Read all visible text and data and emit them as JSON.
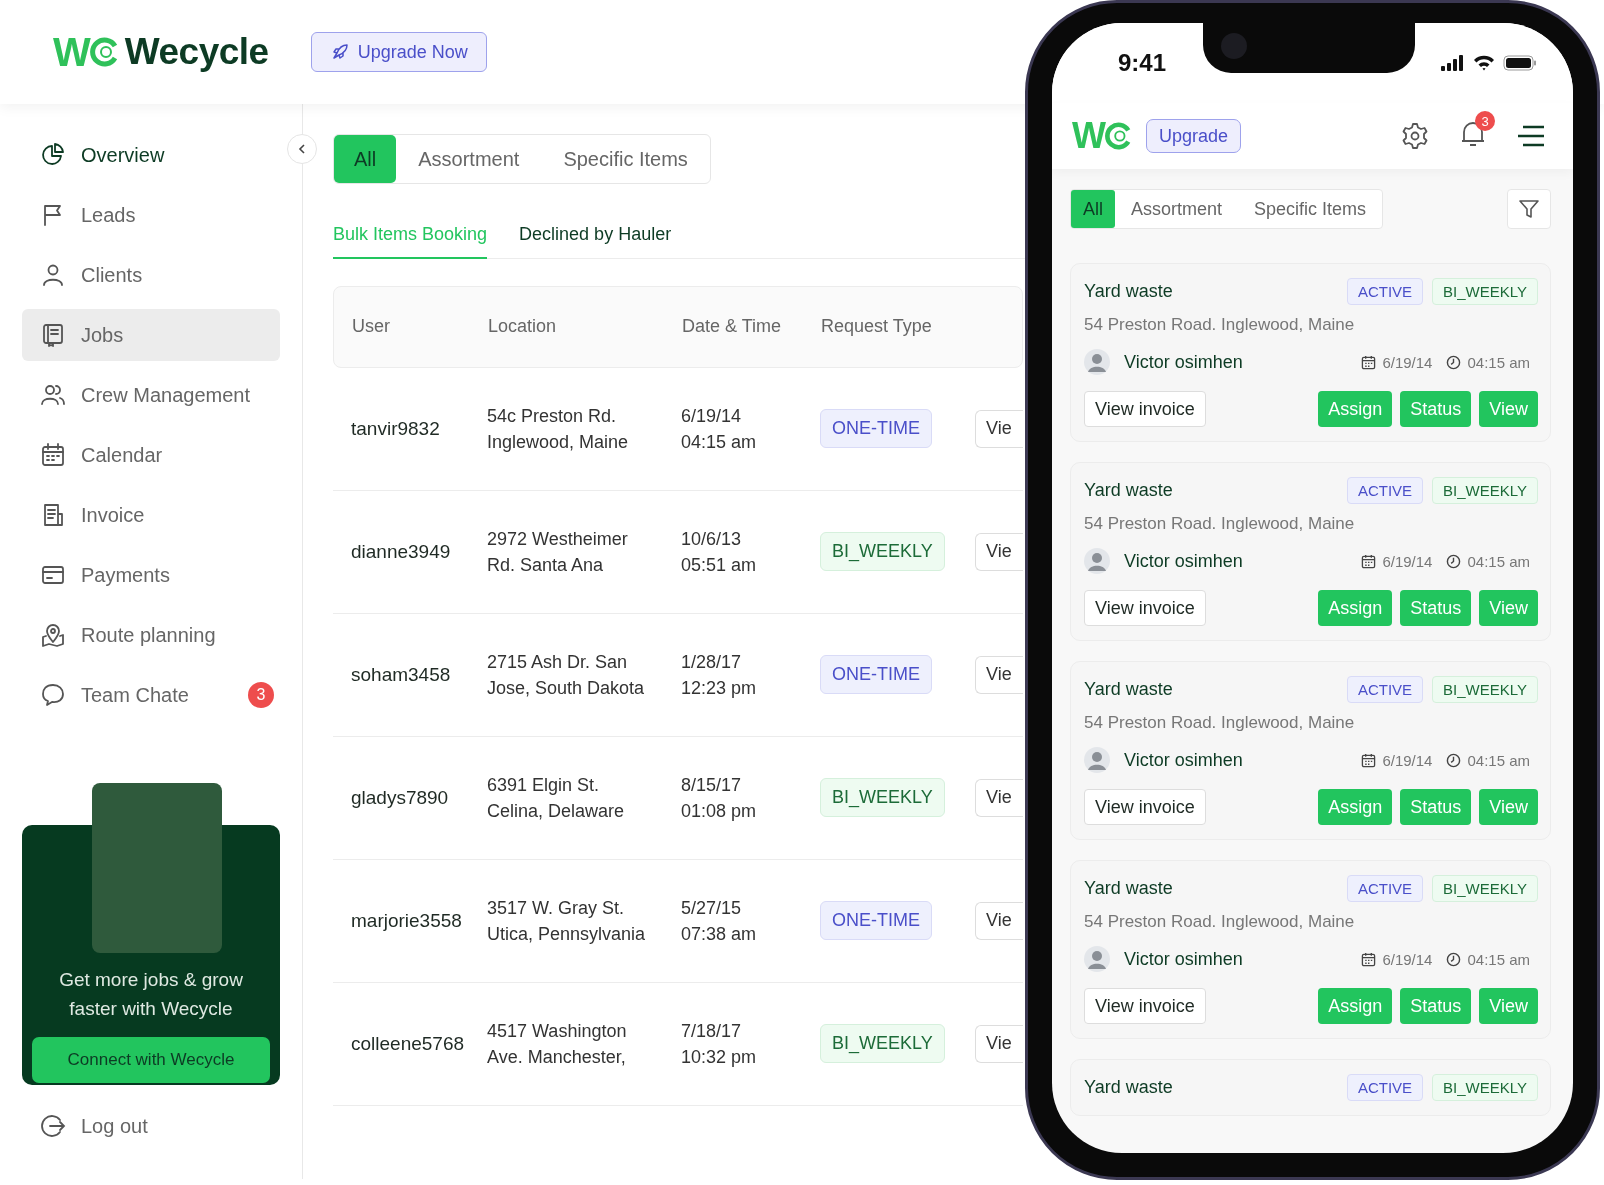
{
  "brand": {
    "logo_letter": "W",
    "name": "Wecycle"
  },
  "upgrade_button": "Upgrade Now",
  "sidebar": {
    "items": [
      {
        "label": "Overview",
        "selected": true,
        "highlighted": false
      },
      {
        "label": "Leads",
        "selected": false,
        "highlighted": false
      },
      {
        "label": "Clients",
        "selected": false,
        "highlighted": false
      },
      {
        "label": "Jobs",
        "selected": false,
        "highlighted": true
      },
      {
        "label": "Crew Management",
        "selected": false,
        "highlighted": false
      },
      {
        "label": "Calendar",
        "selected": false,
        "highlighted": false
      },
      {
        "label": "Invoice",
        "selected": false,
        "highlighted": false
      },
      {
        "label": "Payments",
        "selected": false,
        "highlighted": false
      },
      {
        "label": "Route planning",
        "selected": false,
        "highlighted": false
      },
      {
        "label": "Team Chate",
        "selected": false,
        "highlighted": false,
        "badge": "3"
      }
    ],
    "promo": {
      "text": "Get more jobs & grow faster with Wecycle",
      "button": "Connect with Wecycle"
    },
    "logout": "Log out"
  },
  "filter_tabs": [
    {
      "label": "All",
      "selected": true
    },
    {
      "label": "Assortment",
      "selected": false
    },
    {
      "label": "Specific Items",
      "selected": false
    }
  ],
  "sub_tabs": [
    {
      "label": "Bulk Items Booking",
      "selected": true
    },
    {
      "label": "Declined by Hauler",
      "selected": false
    }
  ],
  "table": {
    "columns": [
      "User",
      "Location",
      "Date & Time",
      "Request Type"
    ],
    "rows": [
      {
        "user": "tanvir9832",
        "location": "54c Preston Rd. Inglewood, Maine",
        "date": "6/19/14",
        "time": "04:15 am",
        "request_type": "ONE-TIME",
        "kind": "one_time",
        "action": "Vie"
      },
      {
        "user": "dianne3949",
        "location": "2972 Westheimer Rd. Santa Ana",
        "date": "10/6/13",
        "time": "05:51 am",
        "request_type": "BI_WEEKLY",
        "kind": "bi_weekly",
        "action": "Vie"
      },
      {
        "user": "soham3458",
        "location": "2715 Ash Dr. San Jose, South Dakota",
        "date": "1/28/17",
        "time": "12:23 pm",
        "request_type": "ONE-TIME",
        "kind": "one_time",
        "action": "Vie"
      },
      {
        "user": "gladys7890",
        "location": "6391 Elgin St. Celina, Delaware",
        "date": "8/15/17",
        "time": "01:08 pm",
        "request_type": "BI_WEEKLY",
        "kind": "bi_weekly",
        "action": "Vie"
      },
      {
        "user": "marjorie3558",
        "location": "3517 W. Gray St. Utica, Pennsylvania",
        "date": "5/27/15",
        "time": "07:38 am",
        "request_type": "ONE-TIME",
        "kind": "one_time",
        "action": "Vie"
      },
      {
        "user": "colleene5768",
        "location": "4517 Washington Ave. Manchester,",
        "date": "7/18/17",
        "time": "10:32 pm",
        "request_type": "BI_WEEKLY",
        "kind": "bi_weekly",
        "action": "Vie"
      }
    ]
  },
  "phone": {
    "status_time": "9:41",
    "logo_letter": "W",
    "upgrade_button": "Upgrade",
    "notification_count": "3",
    "tabs": [
      {
        "label": "All",
        "selected": true
      },
      {
        "label": "Assortment",
        "selected": false
      },
      {
        "label": "Specific Items",
        "selected": false
      }
    ],
    "cards": [
      {
        "title": "Yard waste",
        "status": "ACTIVE",
        "frequency": "BI_WEEKLY",
        "address": "54 Preston Road. Inglewood, Maine",
        "person": "Victor osimhen",
        "date": "6/19/14",
        "time": "04:15 am",
        "buttons": [
          "View invoice",
          "Assign",
          "Status",
          "View"
        ]
      },
      {
        "title": "Yard waste",
        "status": "ACTIVE",
        "frequency": "BI_WEEKLY",
        "address": "54 Preston Road. Inglewood, Maine",
        "person": "Victor osimhen",
        "date": "6/19/14",
        "time": "04:15 am",
        "buttons": [
          "View invoice",
          "Assign",
          "Status",
          "View"
        ]
      },
      {
        "title": "Yard waste",
        "status": "ACTIVE",
        "frequency": "BI_WEEKLY",
        "address": "54 Preston Road. Inglewood, Maine",
        "person": "Victor osimhen",
        "date": "6/19/14",
        "time": "04:15 am",
        "buttons": [
          "View invoice",
          "Assign",
          "Status",
          "View"
        ]
      },
      {
        "title": "Yard waste",
        "status": "ACTIVE",
        "frequency": "BI_WEEKLY",
        "address": "54 Preston Road. Inglewood, Maine",
        "person": "Victor osimhen",
        "date": "6/19/14",
        "time": "04:15 am",
        "buttons": [
          "View invoice",
          "Assign",
          "Status",
          "View"
        ]
      },
      {
        "title": "Yard waste",
        "status": "ACTIVE",
        "frequency": "BI_WEEKLY"
      }
    ]
  }
}
